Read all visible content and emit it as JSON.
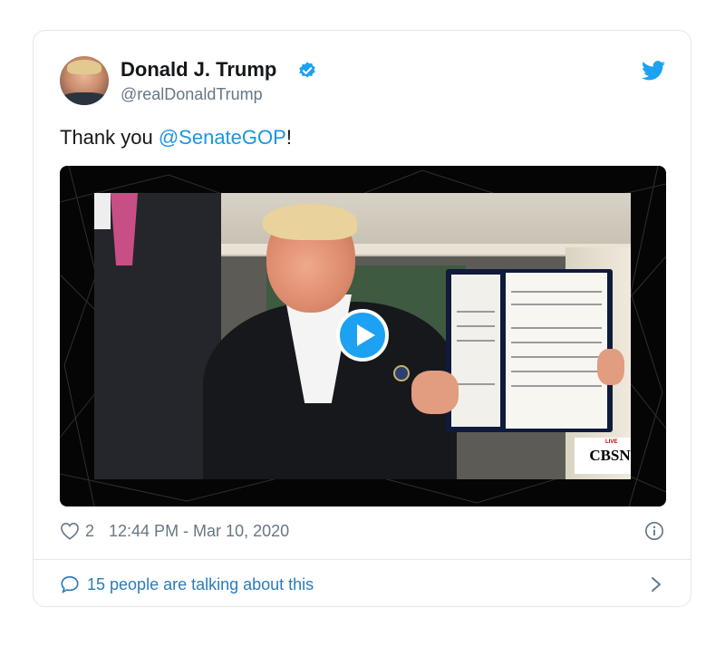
{
  "tweet": {
    "author_name": "Donald J. Trump",
    "author_handle": "@realDonaldTrump",
    "text_before": "Thank you ",
    "mention": "@SenateGOP",
    "text_after": "!",
    "likes": "2",
    "timestamp": "12:44 PM - Mar 10, 2020",
    "talking_label": "15 people are talking about this"
  },
  "media": {
    "watermark": "CBSN",
    "watermark_live": "LIVE"
  },
  "icons": {
    "verified": "verified-badge-icon",
    "brand": "twitter-bird-icon",
    "play": "play-icon",
    "like": "heart-icon",
    "info": "info-icon",
    "conversation": "speech-bubble-icon",
    "chevron": "chevron-right-icon"
  },
  "colors": {
    "accent": "#1da1f2",
    "link": "#1b95e0",
    "muted": "#657786",
    "border": "#e1e8ed"
  }
}
